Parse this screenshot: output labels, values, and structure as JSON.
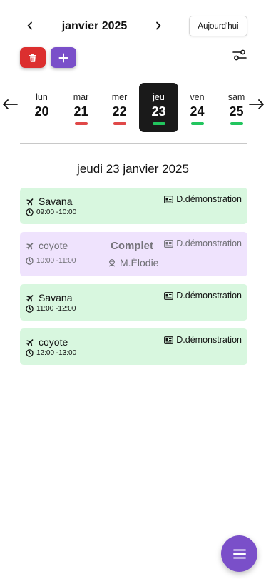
{
  "header": {
    "month_label": "janvier 2025",
    "today_label": "Aujourd'hui"
  },
  "toolbar": {
    "delete_icon": "trash-icon",
    "add_icon": "plus-icon",
    "filter_icon": "sliders-icon"
  },
  "week": {
    "days": [
      {
        "name": "lun",
        "num": "20",
        "mark": ""
      },
      {
        "name": "mar",
        "num": "21",
        "mark": "#e04848"
      },
      {
        "name": "mer",
        "num": "22",
        "mark": "#e04848"
      },
      {
        "name": "jeu",
        "num": "23",
        "mark": "#22c55e",
        "selected": true
      },
      {
        "name": "ven",
        "num": "24",
        "mark": "#22c55e"
      },
      {
        "name": "sam",
        "num": "25",
        "mark": "#22c55e"
      }
    ]
  },
  "selected_date": "jeudi 23 janvier 2025",
  "events": [
    {
      "title": "Savana",
      "time": "09:00 -10:00",
      "place": "D.démonstration",
      "status": "",
      "instructor": "",
      "color": "#d8f7df"
    },
    {
      "title": "coyote",
      "time": "10:00 -11:00",
      "place": "D.démonstration",
      "status": "Complet",
      "instructor": "M.Élodie",
      "color": "#efe3fd"
    },
    {
      "title": "Savana",
      "time": "11:00 -12:00",
      "place": "D.démonstration",
      "status": "",
      "instructor": "",
      "color": "#d8f7df"
    },
    {
      "title": "coyote",
      "time": "12:00 -13:00",
      "place": "D.démonstration",
      "status": "",
      "instructor": "",
      "color": "#d8f7df"
    }
  ],
  "colors": {
    "accent_purple": "#7a4fc9",
    "danger_red": "#dc2f2f",
    "available_green": "#d8f7df",
    "full_purple": "#efe3fd"
  }
}
